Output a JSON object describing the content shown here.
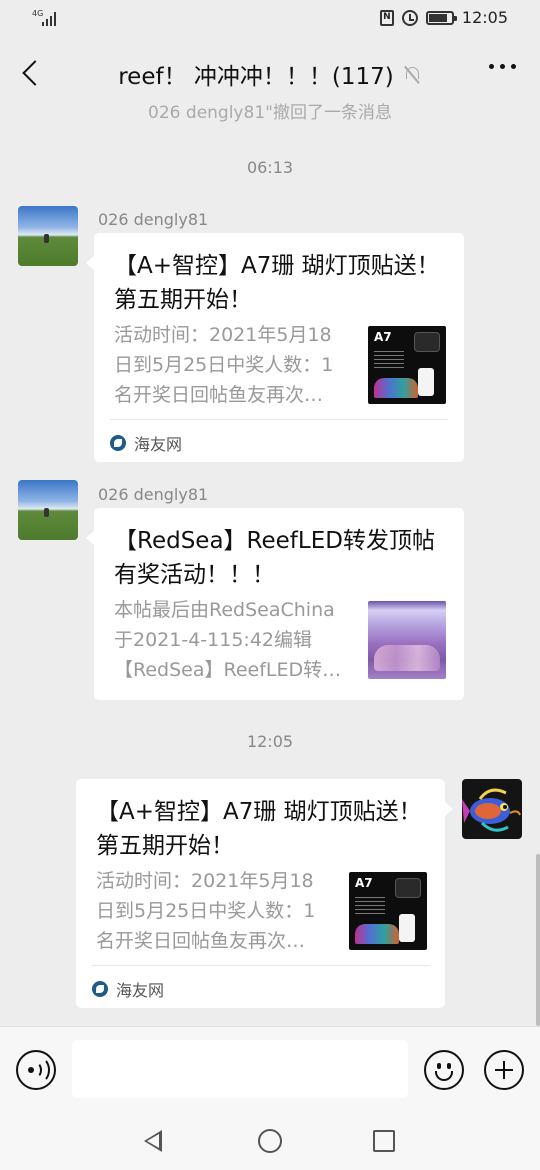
{
  "status_bar": {
    "network": "4G",
    "time": "12:05",
    "nfc_label": "N"
  },
  "header": {
    "title": "reef！ 冲冲冲！！！(117)",
    "back_icon": "back-chevron-icon",
    "mute_icon": "mute-bell-icon",
    "more_icon": "more-dots-icon"
  },
  "chat": {
    "recall_note": "026 dengly81\"撤回了一条消息",
    "messages": [
      {
        "timestamp": "06:13",
        "sender": "026 dengly81",
        "side": "left",
        "title": "【A+智控】A7珊 瑚灯顶贴送！第五期开始！",
        "description": "活动时间：2021年5月18日到5月25日中奖人数：1名开奖日回帖鱼友再次…",
        "thumbnail": "a7-coral-lamp",
        "thumbnail_label": "A7",
        "source": "海友网"
      },
      {
        "sender": "026 dengly81",
        "side": "left",
        "title": "【RedSea】ReefLED转发顶帖有奖活动！！！",
        "description": "本帖最后由RedSeaChina于2021-4-115:42编辑【RedSea】ReefLED转…",
        "thumbnail": "reef-tank"
      },
      {
        "timestamp": "12:05",
        "side": "right",
        "title": "【A+智控】A7珊 瑚灯顶贴送！第五期开始！",
        "description": "活动时间：2021年5月18日到5月25日中奖人数：1名开奖日回帖鱼友再次…",
        "thumbnail": "a7-coral-lamp",
        "thumbnail_label": "A7",
        "source": "海友网"
      }
    ]
  },
  "input_bar": {
    "voice_icon": "voice-icon",
    "emoji_icon": "emoji-icon",
    "plus_icon": "plus-icon",
    "input_value": ""
  },
  "nav_bar": {
    "back": "nav-back-icon",
    "home": "nav-home-icon",
    "recents": "nav-recents-icon"
  },
  "colors": {
    "background": "#ededed",
    "bubble": "#ffffff",
    "muted_text": "#999999",
    "source_icon": "#1e5a8a"
  }
}
